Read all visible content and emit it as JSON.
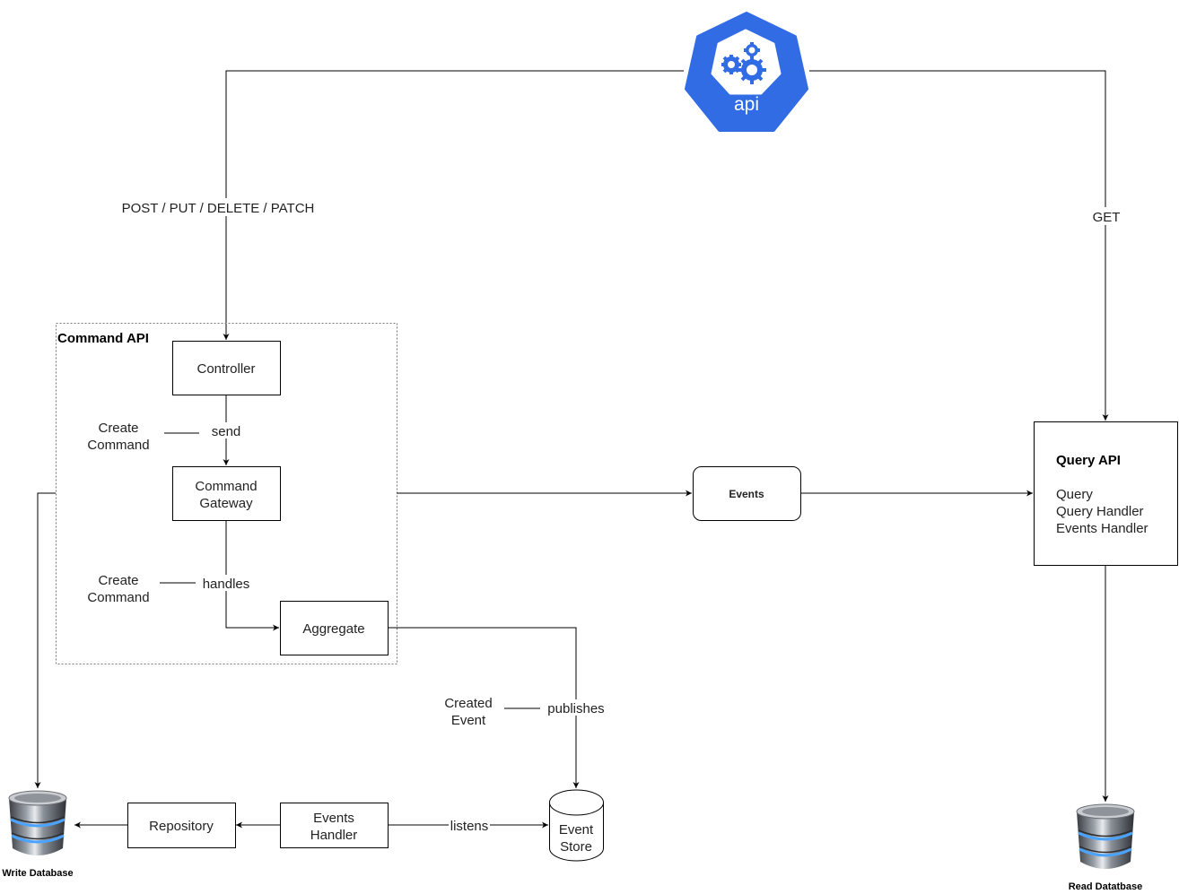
{
  "api_icon": {
    "label": "api",
    "color": "#326ce5",
    "icon": "kubernetes-api-gears-icon"
  },
  "edges": {
    "write_methods": "POST / PUT / DELETE / PATCH",
    "read_method": "GET",
    "send": "send",
    "send_note": [
      "Create",
      "Command"
    ],
    "handles": "handles",
    "handles_note": [
      "Create",
      "Command"
    ],
    "publishes": "publishes",
    "publishes_note": [
      "Created",
      "Event"
    ],
    "listens": "listens"
  },
  "command_api": {
    "title": "Command API",
    "controller": "Controller",
    "command_gateway": [
      "Command",
      "Gateway"
    ],
    "aggregate": "Aggregate"
  },
  "events": "Events",
  "query_api": {
    "title": "Query API",
    "items": [
      "Query",
      "Query Handler",
      "Events Handler"
    ]
  },
  "event_store": [
    "Event",
    "Store"
  ],
  "events_handler": [
    "Events",
    "Handler"
  ],
  "repository": "Repository",
  "write_database": "Write Database",
  "read_database": "Read Datatbase"
}
